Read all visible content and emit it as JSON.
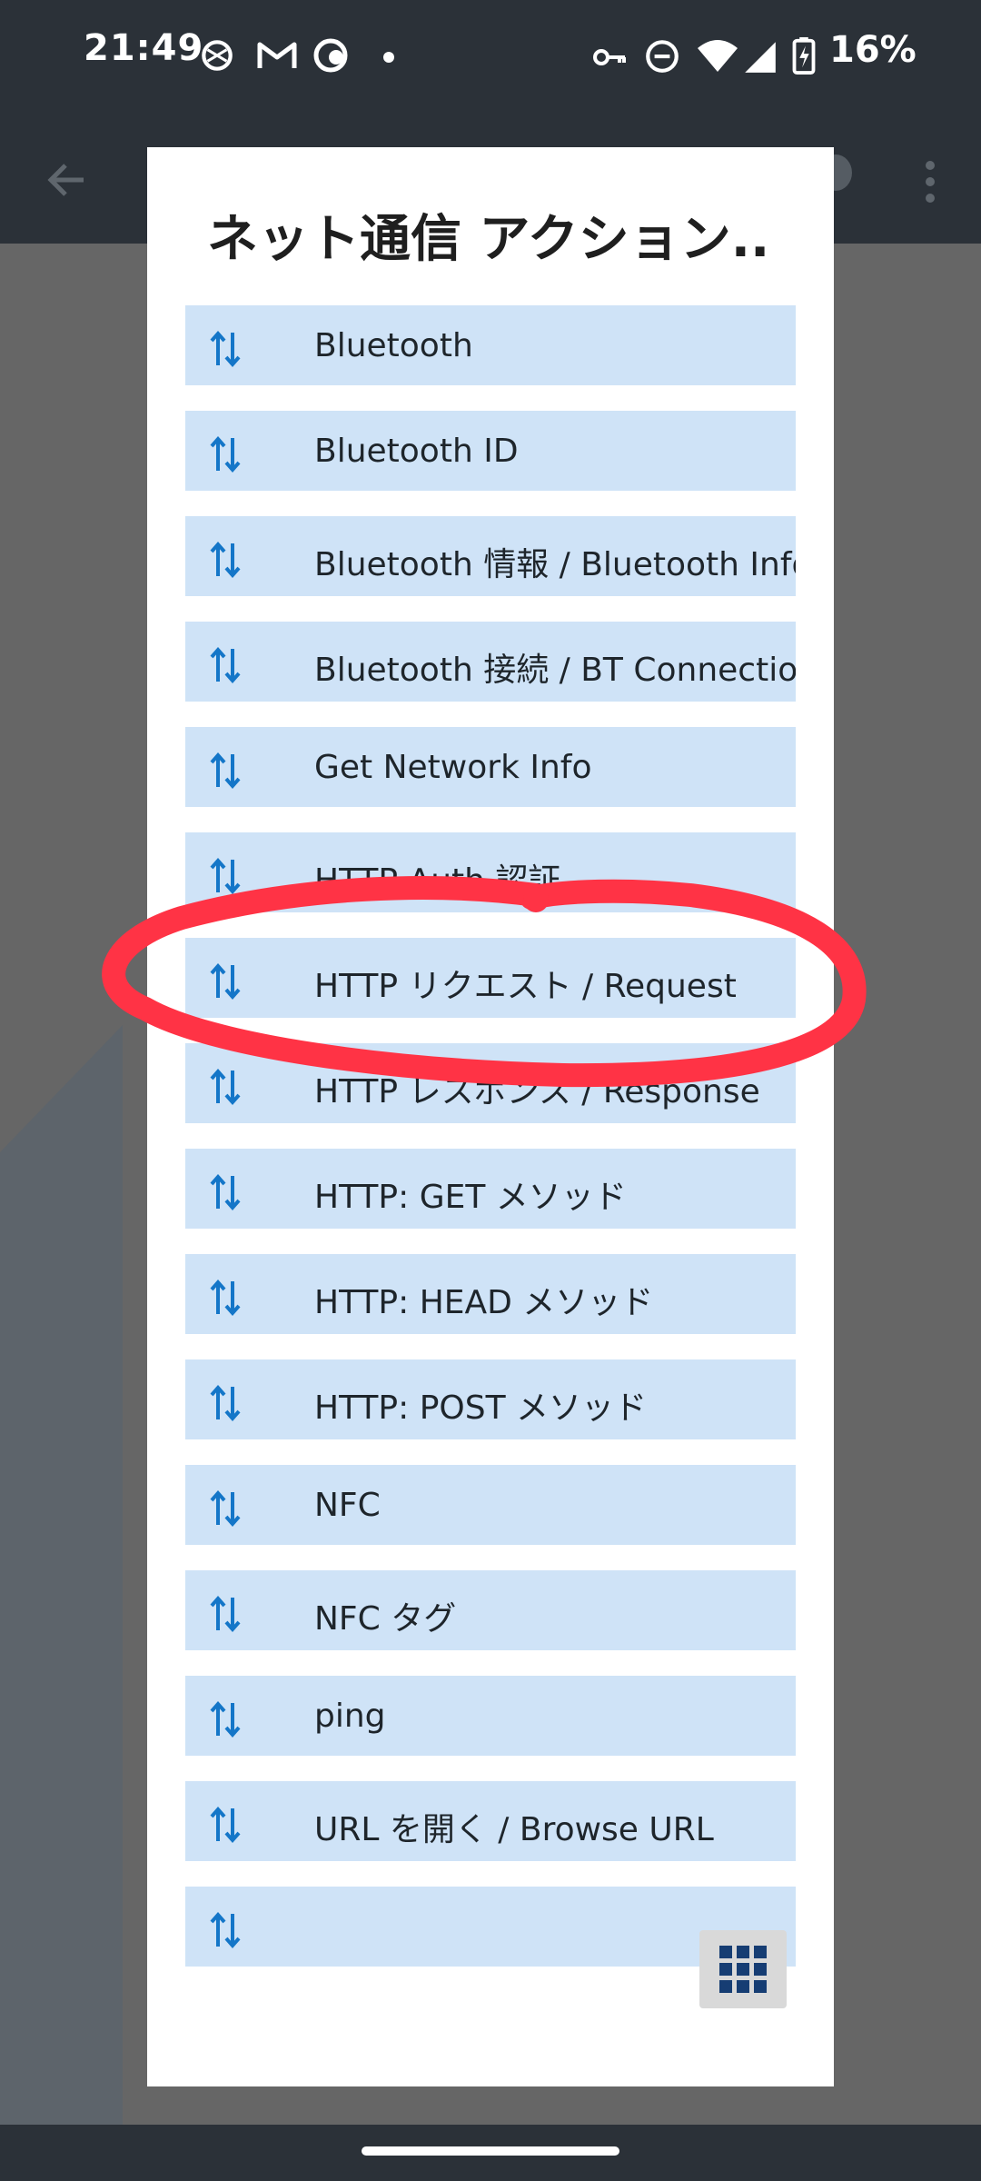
{
  "status_bar": {
    "time": "21:49",
    "battery_percent": "16%",
    "icons": [
      "whisker-app-icon",
      "gmail-icon",
      "cloud-icon",
      "dot-icon",
      "key-icon",
      "dnd-icon",
      "wifi-icon",
      "signal-icon",
      "battery-charging-icon"
    ]
  },
  "app_bar": {
    "back_icon": "back-arrow-icon",
    "overflow_icon": "more-vert-icon"
  },
  "dialog": {
    "title": "ネット通信 アクション...",
    "items": [
      {
        "label": "Bluetooth",
        "icon": "swap-vertical-icon"
      },
      {
        "label": "Bluetooth ID",
        "icon": "swap-vertical-icon"
      },
      {
        "label": "Bluetooth 情報 / Bluetooth Info",
        "icon": "swap-vertical-icon"
      },
      {
        "label": "Bluetooth 接続 / BT Connection",
        "icon": "swap-vertical-icon"
      },
      {
        "label": "Get Network Info",
        "icon": "swap-vertical-icon"
      },
      {
        "label": "HTTP Auth 認証",
        "icon": "swap-vertical-icon"
      },
      {
        "label": "HTTP リクエスト / Request",
        "icon": "swap-vertical-icon"
      },
      {
        "label": "HTTP レスポンス / Response",
        "icon": "swap-vertical-icon"
      },
      {
        "label": "HTTP: GET メソッド",
        "icon": "swap-vertical-icon"
      },
      {
        "label": "HTTP: HEAD メソッド",
        "icon": "swap-vertical-icon"
      },
      {
        "label": "HTTP: POST メソッド",
        "icon": "swap-vertical-icon"
      },
      {
        "label": "NFC",
        "icon": "swap-vertical-icon"
      },
      {
        "label": "NFC タグ",
        "icon": "swap-vertical-icon"
      },
      {
        "label": "ping",
        "icon": "swap-vertical-icon"
      },
      {
        "label": "URL を開く / Browse URL",
        "icon": "swap-vertical-icon"
      },
      {
        "label": "",
        "icon": "swap-vertical-icon"
      }
    ],
    "grid_button_icon": "grid-view-icon"
  },
  "colors": {
    "status_bar": "#2b3138",
    "scrim": "#666666",
    "item_bg": "#cfe3f7",
    "icon_blue": "#1476c8",
    "annotation_red": "#ff3345"
  }
}
